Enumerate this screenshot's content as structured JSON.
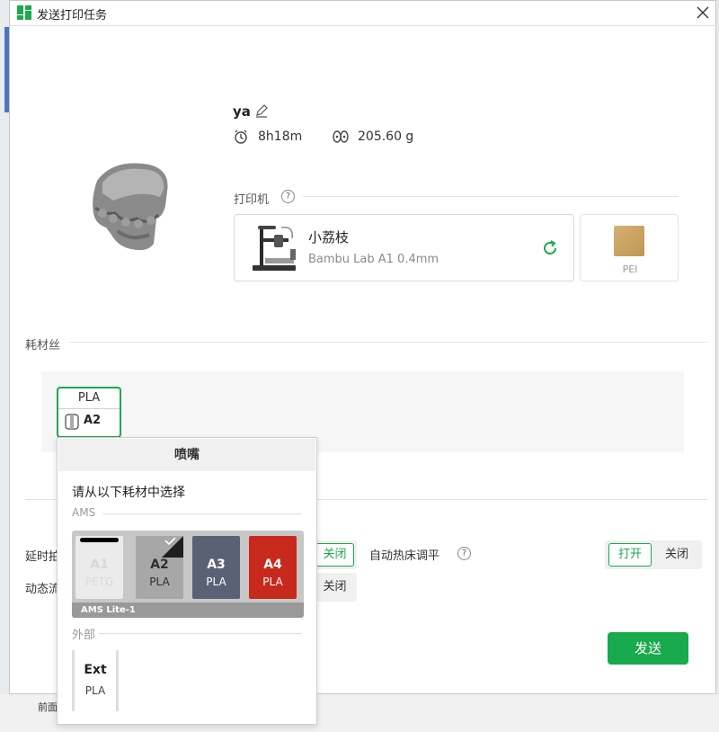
{
  "window": {
    "title": "发送打印任务",
    "close_icon": "close-icon"
  },
  "task": {
    "name": "ya",
    "time": "8h18m",
    "weight": "205.60 g"
  },
  "printer_section": {
    "label": "打印机"
  },
  "printer": {
    "name": "小荔枝",
    "model": "Bambu Lab A1  0.4mm"
  },
  "plate": {
    "label": "PEI"
  },
  "filament_section": {
    "label": "耗材丝"
  },
  "filament_chip": {
    "material": "PLA",
    "slot": "A2"
  },
  "options": {
    "timelapse_label": "延时拍",
    "dynamic_label": "动态流",
    "off_label": "关闭",
    "on_label": "打开",
    "auto_level_label": "自动热床调平"
  },
  "popup": {
    "header": "喷嘴",
    "prompt": "请从以下耗材中选择",
    "ams_label": "AMS",
    "ams_unit": "AMS Lite-1",
    "slots": [
      {
        "id": "A1",
        "material": "PETG",
        "bar_color": "#000000",
        "bg": "#ebebeb",
        "text": "#d8d8d8",
        "selected": false
      },
      {
        "id": "A2",
        "material": "PLA",
        "bar_color": "#a7a7a7",
        "bg": "#a7a7a7",
        "text": "#2e2e2e",
        "selected": true
      },
      {
        "id": "A3",
        "material": "PLA",
        "bar_color": "#5a6174",
        "bg": "#5a6174",
        "text": "#ffffff",
        "selected": false
      },
      {
        "id": "A4",
        "material": "PLA",
        "bar_color": "#c8291d",
        "bg": "#c8291d",
        "text": "#ffffff",
        "selected": false
      }
    ],
    "external_label": "外部",
    "external": {
      "id": "Ext",
      "material": "PLA"
    }
  },
  "send_button": {
    "label": "发送"
  },
  "background": {
    "bottom_label": "前面"
  },
  "colors": {
    "accent": "#18aa4c"
  }
}
